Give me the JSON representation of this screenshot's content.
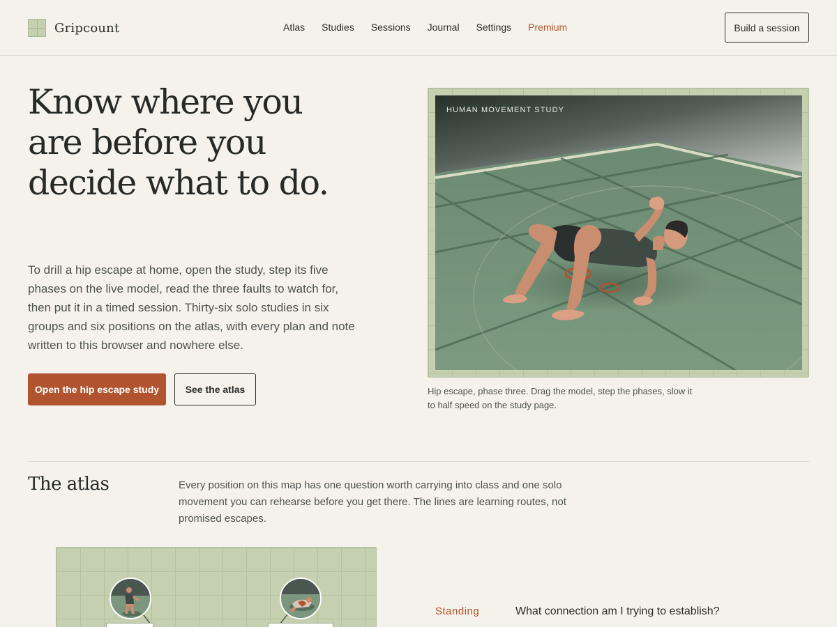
{
  "brand": {
    "name": "Gripcount"
  },
  "nav": {
    "items": [
      "Atlas",
      "Studies",
      "Sessions",
      "Journal",
      "Settings"
    ],
    "premium": "Premium"
  },
  "header": {
    "cta": "Build a session"
  },
  "hero": {
    "title": "Know where you are before you decide what to do.",
    "body": "To drill a hip escape at home, open the study, step its five phases on the live model, read the three faults to watch for, then put it in a timed session. Thirty-six solo studies in six groups and six positions on the atlas, with every plan and note written to this browser and nowhere else.",
    "primary_cta": "Open the hip escape study",
    "secondary_cta": "See the atlas"
  },
  "viewer": {
    "label": "HUMAN MOVEMENT STUDY",
    "caption": "Hip escape, phase three. Drag the model, step the phases, slow it to half speed on the study page."
  },
  "atlas": {
    "title": "The atlas",
    "body": "Every position on this map has one question worth carrying into class and one solo movement you can rehearse before you get there. The lines are learning routes, not promised escapes.",
    "first_position": {
      "name": "Standing",
      "question": "What connection am I trying to establish?"
    }
  },
  "colors": {
    "accent": "#b0532e",
    "mat": "#c5d0b0",
    "background": "#f5f2eb",
    "text": "#252a27"
  }
}
